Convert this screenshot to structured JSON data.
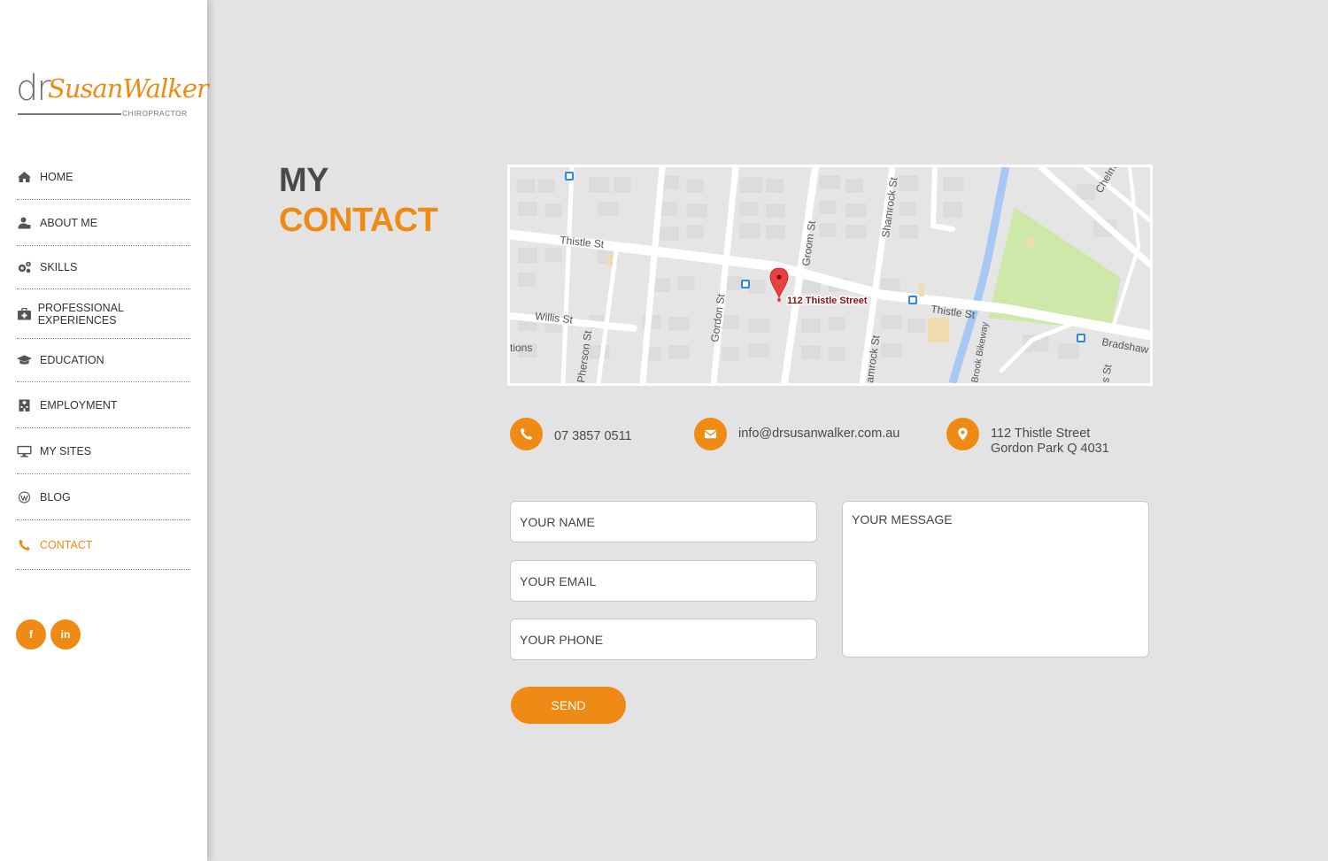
{
  "logo": {
    "prefix": "dr",
    "name": "SusanWalker",
    "subtitle": "CHIROPRACTOR"
  },
  "nav": {
    "items": [
      {
        "label": "HOME",
        "icon": "home-icon"
      },
      {
        "label": "ABOUT ME",
        "icon": "user-icon"
      },
      {
        "label": "SKILLS",
        "icon": "gears-icon"
      },
      {
        "label": "PROFESSIONAL EXPERIENCES",
        "icon": "medkit-icon"
      },
      {
        "label": "EDUCATION",
        "icon": "graduation-cap-icon"
      },
      {
        "label": "EMPLOYMENT",
        "icon": "hospital-icon"
      },
      {
        "label": "MY SITES",
        "icon": "desktop-icon"
      },
      {
        "label": "BLOG",
        "icon": "wordpress-icon"
      },
      {
        "label": "CONTACT",
        "icon": "phone-icon",
        "active": true
      }
    ]
  },
  "social": {
    "facebook": "f",
    "linkedin": "in"
  },
  "page": {
    "title_line1": "MY",
    "title_line2": "CONTACT"
  },
  "map": {
    "marker_label": "112 Thistle Street",
    "streets": [
      "Thistle St",
      "Willis St",
      "Gordon St",
      "Groom St",
      "Shamrock St",
      "Thistle St",
      "Bradshaw",
      "Brook Bikeway",
      "Pherson St",
      "tions",
      "Chelm",
      "s St",
      "amrock St"
    ]
  },
  "contact": {
    "phone": "07 3857 0511",
    "email": "info@drsusanwalker.com.au",
    "address_line1": "112 Thistle Street",
    "address_line2": "Gordon Park Q 4031"
  },
  "form": {
    "name_placeholder": "YOUR NAME",
    "email_placeholder": "YOUR EMAIL",
    "phone_placeholder": "YOUR PHONE",
    "message_placeholder": "YOUR MESSAGE",
    "send_label": "SEND"
  },
  "colors": {
    "accent": "#ef8b14",
    "background": "#e3e3e3",
    "sidebar": "#ffffff",
    "text": "#4a4a4a"
  }
}
